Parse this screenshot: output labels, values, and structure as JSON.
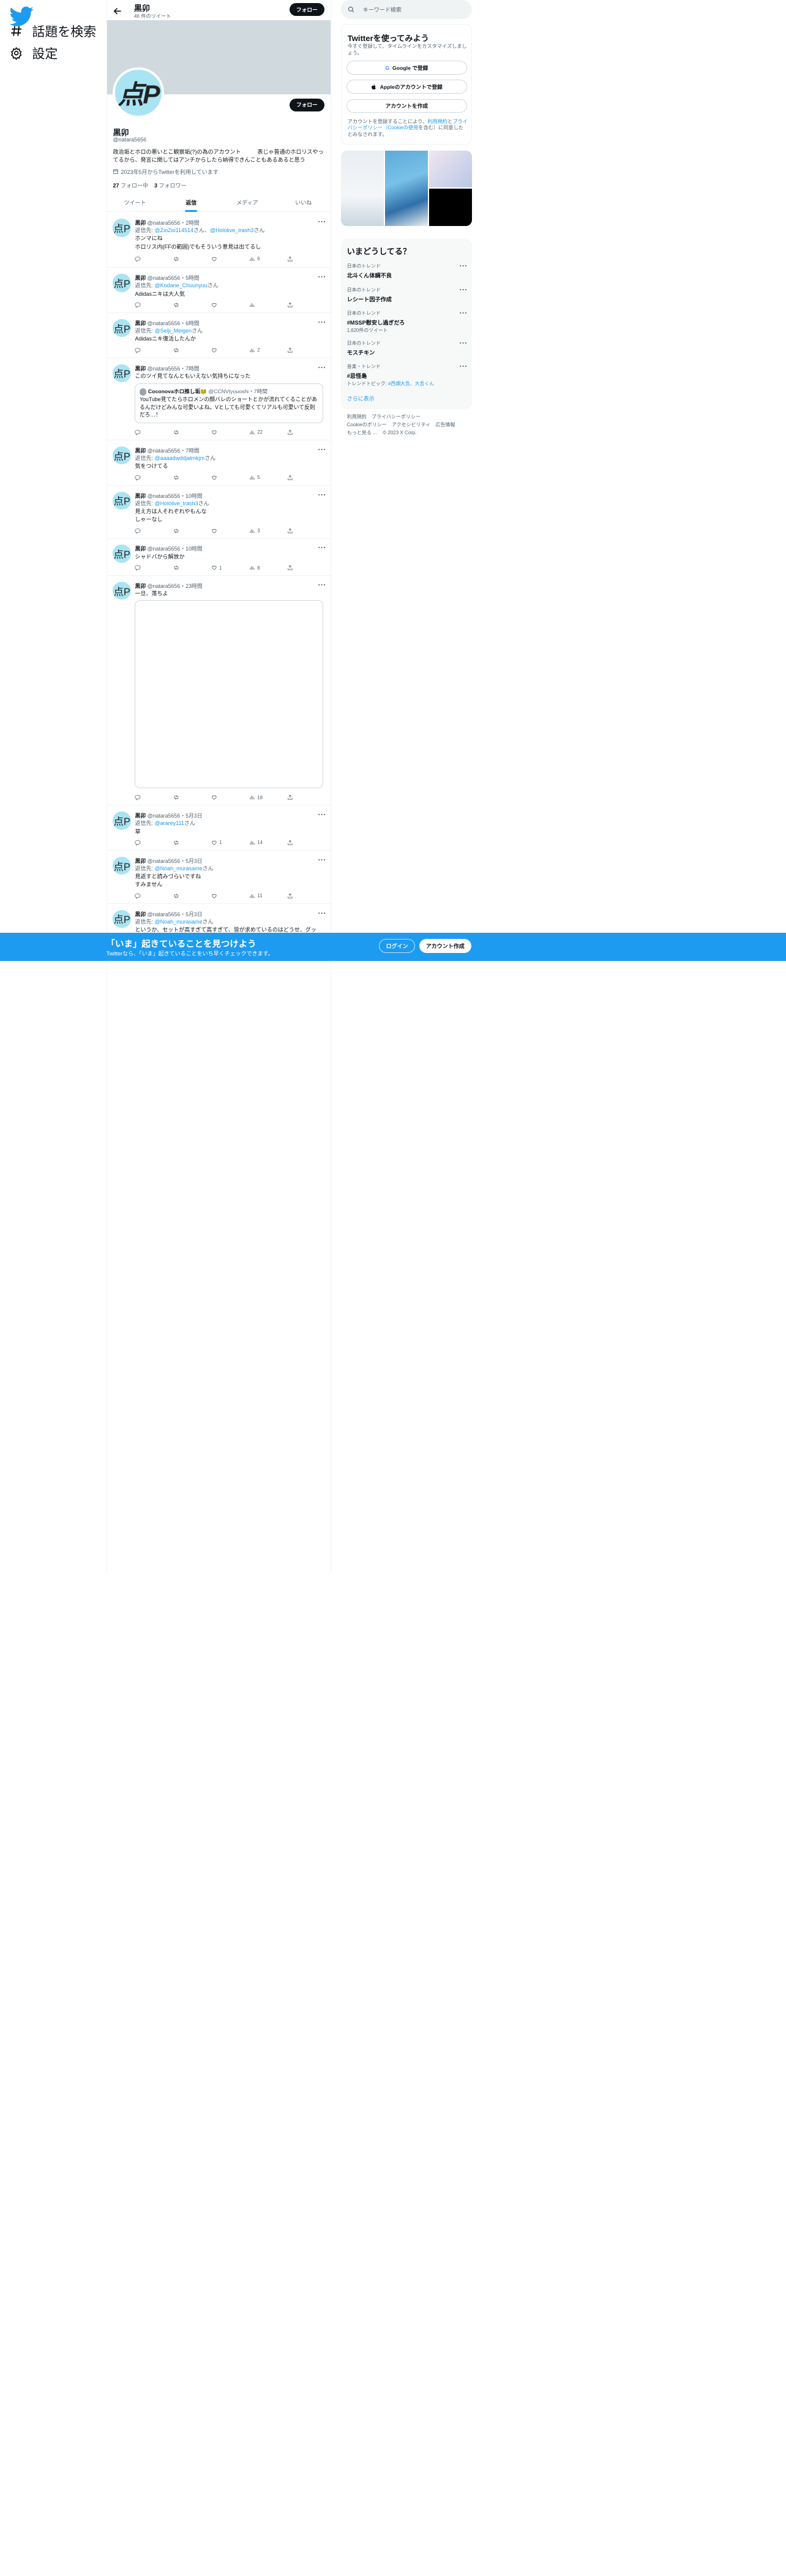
{
  "nav": {
    "explore_label": "話題を検索",
    "settings_label": "設定"
  },
  "header": {
    "name": "黒卯",
    "tweet_count": "46 件のツイート",
    "follow_label": "フォロー"
  },
  "profile": {
    "avatar_text": "点P",
    "name": "黒卯",
    "handle": "@natara5656",
    "bio": "政治垢とホロの悪いとこ観察垢(?)の為のアカウント　　　表じゃ普通のホロリスやってるから、発言に関してはアンチからしたら納得できんこともあるあると思う",
    "joined": "2023年5月からTwitterを利用しています",
    "following_count": "27",
    "following_label": " フォロー中",
    "followers_count": "3",
    "followers_label": " フォロワー",
    "follow_label": "フォロー"
  },
  "tabs": [
    "ツイート",
    "返信",
    "メディア",
    "いいね"
  ],
  "tweets": [
    {
      "name": "黒卯",
      "meta": " @natara5656・2時間",
      "reply_prefix": "返信先: ",
      "reply_to": "@ZioZio114514",
      "reply_sep": "さん、",
      "reply_to2": "@Hololive_trash3",
      "reply_suffix": "さん",
      "text1": "ホンマにね",
      "text2": "ホロリス内(FFの範囲)でもそういう意見は出てるし",
      "likes": "",
      "views": "6"
    },
    {
      "name": "黒卯",
      "meta": " @natara5656・5時間",
      "reply_prefix": "返信先: ",
      "reply_to": "@Kodane_Chuunyuu",
      "reply_suffix": "さん",
      "text1": "Adidasニキは大人気",
      "likes": "",
      "views": ""
    },
    {
      "name": "黒卯",
      "meta": " @natara5656・6時間",
      "reply_prefix": "返信先: ",
      "reply_to": "@Seiji_Meigen",
      "reply_suffix": "さん",
      "text1": "Adidasニキ復活したんか",
      "likes": "",
      "views": "2"
    },
    {
      "name": "黒卯",
      "meta": " @natara5656・7時間",
      "text1": "このツイ見てなんともいえない気持ちになった",
      "quote": {
        "name": "Coconovaホロ推し垢🐸",
        "meta": " @CCNVtyouoshi・7時間",
        "text": "YouTube見てたらホロメンの顔バレのショートとかが流れてくることがあるんだけどみんな可愛いよね。Vとしても可愛くてリアルも可愛いて反則だろ…！"
      },
      "likes": "",
      "views": "22"
    },
    {
      "name": "黒卯",
      "meta": " @natara5656・7時間",
      "reply_prefix": "返信先: ",
      "reply_to": "@aaaadwddjatmkjm",
      "reply_suffix": "さん",
      "text1": "気をつけてる",
      "likes": "",
      "views": "5"
    },
    {
      "name": "黒卯",
      "meta": " @natara5656・10時間",
      "reply_prefix": "返信先: ",
      "reply_to": "@Hololive_trash3",
      "reply_suffix": "さん",
      "text1": "見え方は人それぞれやもんな",
      "text2": "しゃーなし",
      "likes": "",
      "views": "3"
    },
    {
      "name": "黒卯",
      "meta": " @natara5656・10時間",
      "text1": "シャドバから解放か",
      "likes": "1",
      "views": "8"
    },
    {
      "name": "黒卯",
      "meta": " @natara5656・23時間",
      "text1": "一旦、落ちよ",
      "likes": "",
      "views": "18"
    },
    {
      "name": "黒卯",
      "meta": " @natara5656・5月3日",
      "reply_prefix": "返信先: ",
      "reply_to": "@ararey111",
      "reply_suffix": "さん",
      "text1": "草",
      "likes": "1",
      "views": "14"
    },
    {
      "name": "黒卯",
      "meta": " @natara5656・5月3日",
      "reply_prefix": "返信先: ",
      "reply_to": "@Noah_murasame",
      "reply_suffix": "さん",
      "text1": "見返すと読みづらいですね",
      "text2": "すみません",
      "likes": "",
      "views": "11"
    },
    {
      "name": "黒卯",
      "meta": " @natara5656・5月3日",
      "reply_prefix": "返信先: ",
      "reply_to": "@Noah_murasame",
      "reply_suffix": "さん",
      "text1": "というか、セットが高すぎて高すぎて、皆が求めているのはどうせ、グッ"
    }
  ],
  "search": {
    "placeholder": "キーワード検索"
  },
  "signup": {
    "title": "Twitterを使ってみよう",
    "subtitle": "今すぐ登録して、タイムラインをカスタマイズしましょう。",
    "google_label": "Google で登録",
    "apple_label": "Appleのアカウントで登録",
    "create_label": "アカウントを作成",
    "terms_prefix": "アカウントを登録することにより、",
    "terms_link1": "利用規約",
    "terms_and": "と",
    "terms_link2": "プライバシーポリシー（Cookieの使用",
    "terms_suffix": "を含む）に同意したとみなされます。"
  },
  "trends": {
    "title": "いまどうしてる？",
    "items": [
      {
        "category": "日本のトレンド",
        "name": "北斗くん体調不良",
        "meta": ""
      },
      {
        "category": "日本のトレンド",
        "name": "レシート因子作成",
        "meta": ""
      },
      {
        "category": "日本のトレンド",
        "name": "#MSSP慰安し過ぎだろ",
        "meta": "1,620件のツイート"
      },
      {
        "category": "日本のトレンド",
        "name": "モスチキン",
        "meta": ""
      },
      {
        "category": "音楽・トレンド",
        "name": "#忌怪島",
        "meta_prefix": "トレンドトピック: ",
        "meta_link": "#西畑大吾、大吾くん"
      }
    ],
    "show_more": "さらに表示"
  },
  "footer": {
    "row1": [
      "利用規約",
      "プライバシーポリシー"
    ],
    "row2": [
      "Cookieのポリシー",
      "アクセシビリティ",
      "広告情報"
    ],
    "row3": [
      "もっと見る …",
      "© 2023 X Corp."
    ]
  },
  "bottom_bar": {
    "title": "「いま」起きていることを見つけよう",
    "subtitle": "Twitterなら、「いま」起きていることをいち早くチェックできます。",
    "login_label": "ログイン",
    "signup_label": "アカウント作成"
  },
  "colors": {
    "accent": "#1d9bf0",
    "text": "#0f1419",
    "muted": "#536471",
    "border": "#eff3f4"
  }
}
